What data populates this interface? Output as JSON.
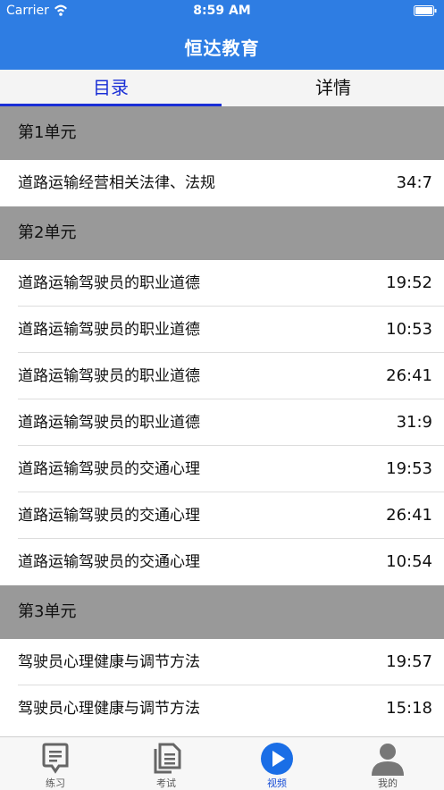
{
  "status_bar": {
    "carrier": "Carrier",
    "time": "8:59 AM"
  },
  "header": {
    "title": "恒达教育"
  },
  "tabs": [
    {
      "label": "目录",
      "active": true
    },
    {
      "label": "详情",
      "active": false
    }
  ],
  "units": [
    {
      "title": "第1单元",
      "items": [
        {
          "title": "道路运输经营相关法律、法规",
          "duration": "34:7"
        }
      ]
    },
    {
      "title": "第2单元",
      "items": [
        {
          "title": "道路运输驾驶员的职业道德",
          "duration": "19:52"
        },
        {
          "title": "道路运输驾驶员的职业道德",
          "duration": "10:53"
        },
        {
          "title": "道路运输驾驶员的职业道德",
          "duration": "26:41"
        },
        {
          "title": "道路运输驾驶员的职业道德",
          "duration": "31:9"
        },
        {
          "title": "道路运输驾驶员的交通心理",
          "duration": "19:53"
        },
        {
          "title": "道路运输驾驶员的交通心理",
          "duration": "26:41"
        },
        {
          "title": "道路运输驾驶员的交通心理",
          "duration": "10:54"
        }
      ]
    },
    {
      "title": "第3单元",
      "items": [
        {
          "title": "驾驶员心理健康与调节方法",
          "duration": "19:57"
        },
        {
          "title": "驾驶员心理健康与调节方法",
          "duration": "15:18"
        }
      ]
    }
  ],
  "tabbar": [
    {
      "label": "练习",
      "icon": "practice-icon",
      "active": false
    },
    {
      "label": "考试",
      "icon": "exam-icon",
      "active": false
    },
    {
      "label": "视频",
      "icon": "video-play-icon",
      "active": true
    },
    {
      "label": "我的",
      "icon": "profile-icon",
      "active": false
    }
  ],
  "colors": {
    "header_bg": "#2e7de3",
    "accent": "#1a2fd6",
    "unit_bg": "#999999",
    "tab_icon_gray": "#666666"
  }
}
